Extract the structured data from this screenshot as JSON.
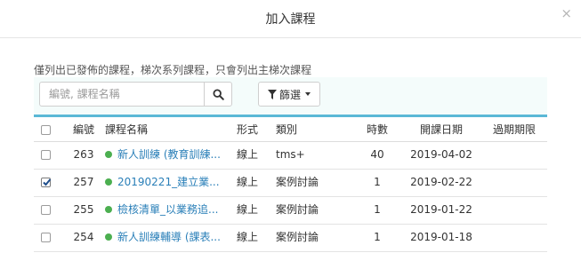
{
  "modal": {
    "title": "加入課程",
    "close_label": "×"
  },
  "note": "僅列出已發佈的課程，梯次系列課程，只會列出主梯次課程",
  "search": {
    "placeholder": "編號, 課程名稱",
    "value": ""
  },
  "filter": {
    "label": "篩選"
  },
  "table": {
    "headers": {
      "code": "編號",
      "name": "課程名稱",
      "form": "形式",
      "category": "類別",
      "hours": "時數",
      "date": "開課日期",
      "expiry": "過期期限"
    },
    "rows": [
      {
        "checked": false,
        "code": "263",
        "name": "新人訓練 (教育訓練...",
        "form": "線上",
        "category": "tms+",
        "hours": "40",
        "date": "2019-04-02",
        "expiry": ""
      },
      {
        "checked": true,
        "code": "257",
        "name": "20190221_建立業...",
        "form": "線上",
        "category": "案例討論",
        "hours": "1",
        "date": "2019-02-22",
        "expiry": ""
      },
      {
        "checked": false,
        "code": "255",
        "name": "檢核清單_以業務追...",
        "form": "線上",
        "category": "案例討論",
        "hours": "1",
        "date": "2019-01-22",
        "expiry": ""
      },
      {
        "checked": false,
        "code": "254",
        "name": "新人訓練輔導 (課表...",
        "form": "線上",
        "category": "案例討論",
        "hours": "1",
        "date": "2019-01-18",
        "expiry": ""
      }
    ]
  },
  "colors": {
    "accent": "#5ab8d6",
    "published_dot": "#4caf50",
    "link": "#2a7fb8",
    "toolbar_bg": "#f4fcfb"
  },
  "icons": {
    "search": "search-icon",
    "filter": "filter-icon",
    "caret": "caret-down-icon",
    "close": "close-icon"
  }
}
